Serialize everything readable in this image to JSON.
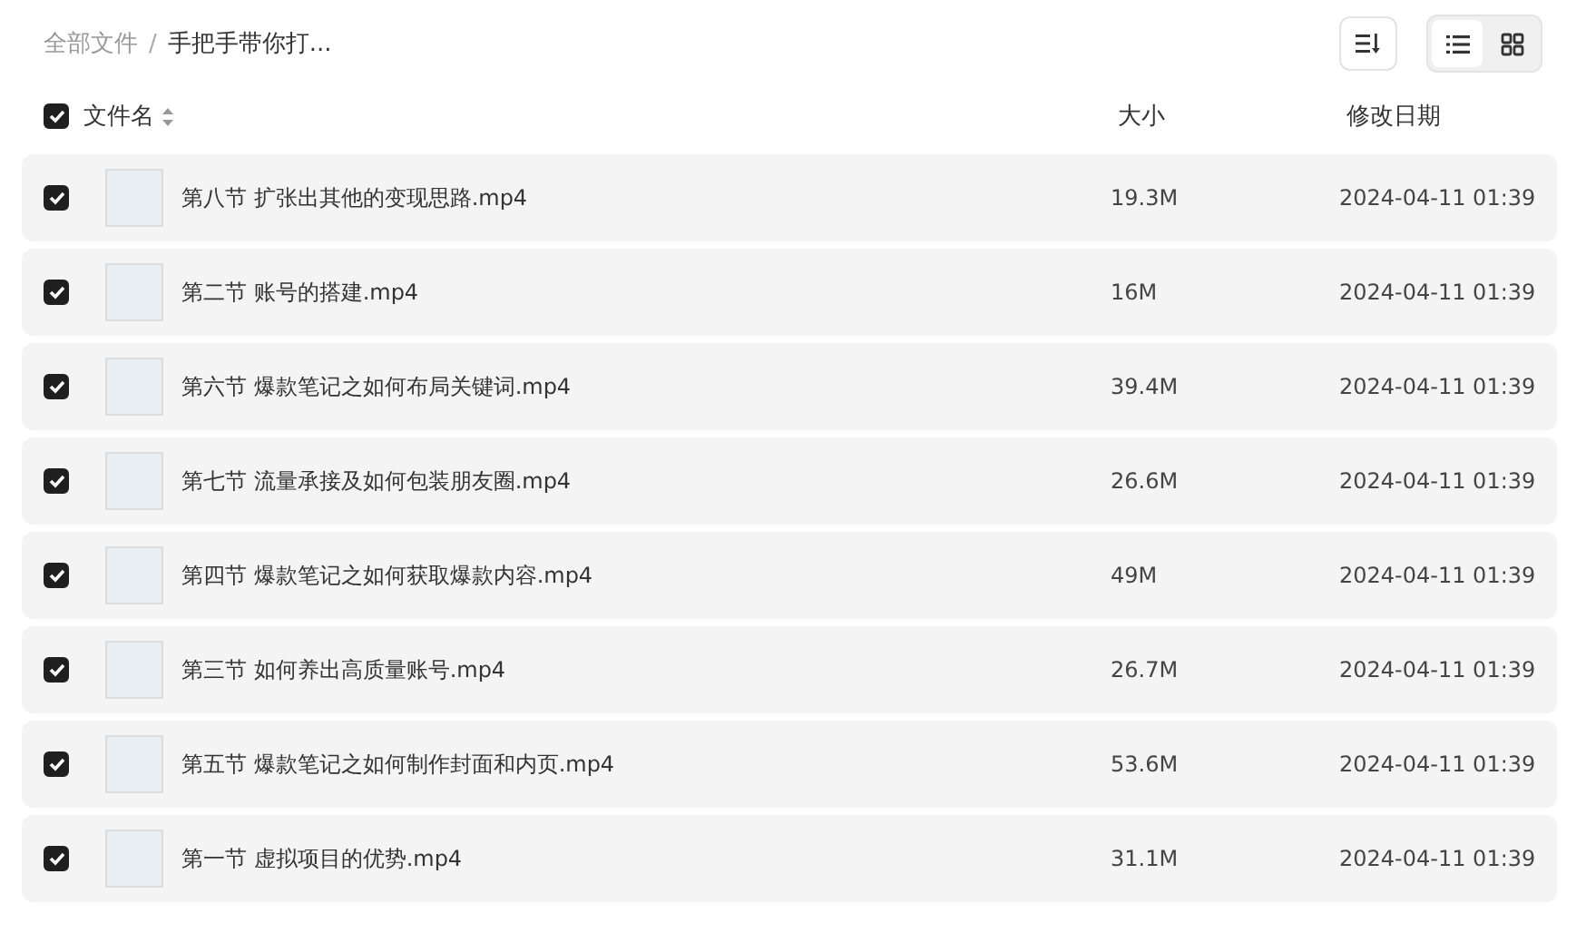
{
  "breadcrumb_separator": "/",
  "breadcrumb": [
    {
      "label": "全部文件",
      "current": false
    },
    {
      "label": "手把手带你打...",
      "current": true
    }
  ],
  "view_toggle": [
    {
      "kind": "list",
      "selected": true
    },
    {
      "kind": "grid",
      "selected": false
    }
  ],
  "header": {
    "checked": true,
    "columns": [
      "文件名",
      "大小",
      "修改日期"
    ]
  },
  "rows": [
    {
      "checked": true,
      "name": "第八节 扩张出其他的变现思路.mp4",
      "size": "19.3M",
      "date": "2024-04-11 01:39"
    },
    {
      "checked": true,
      "name": "第二节 账号的搭建.mp4",
      "size": "16M",
      "date": "2024-04-11 01:39"
    },
    {
      "checked": true,
      "name": "第六节 爆款笔记之如何布局关键词.mp4",
      "size": "39.4M",
      "date": "2024-04-11 01:39"
    },
    {
      "checked": true,
      "name": "第七节 流量承接及如何包装朋友圈.mp4",
      "size": "26.6M",
      "date": "2024-04-11 01:39"
    },
    {
      "checked": true,
      "name": "第四节 爆款笔记之如何获取爆款内容.mp4",
      "size": "49M",
      "date": "2024-04-11 01:39"
    },
    {
      "checked": true,
      "name": "第三节 如何养出高质量账号.mp4",
      "size": "26.7M",
      "date": "2024-04-11 01:39"
    },
    {
      "checked": true,
      "name": "第五节 爆款笔记之如何制作封面和内页.mp4",
      "size": "53.6M",
      "date": "2024-04-11 01:39"
    },
    {
      "checked": true,
      "name": "第一节 虚拟项目的优势.mp4",
      "size": "31.1M",
      "date": "2024-04-11 01:39"
    }
  ]
}
